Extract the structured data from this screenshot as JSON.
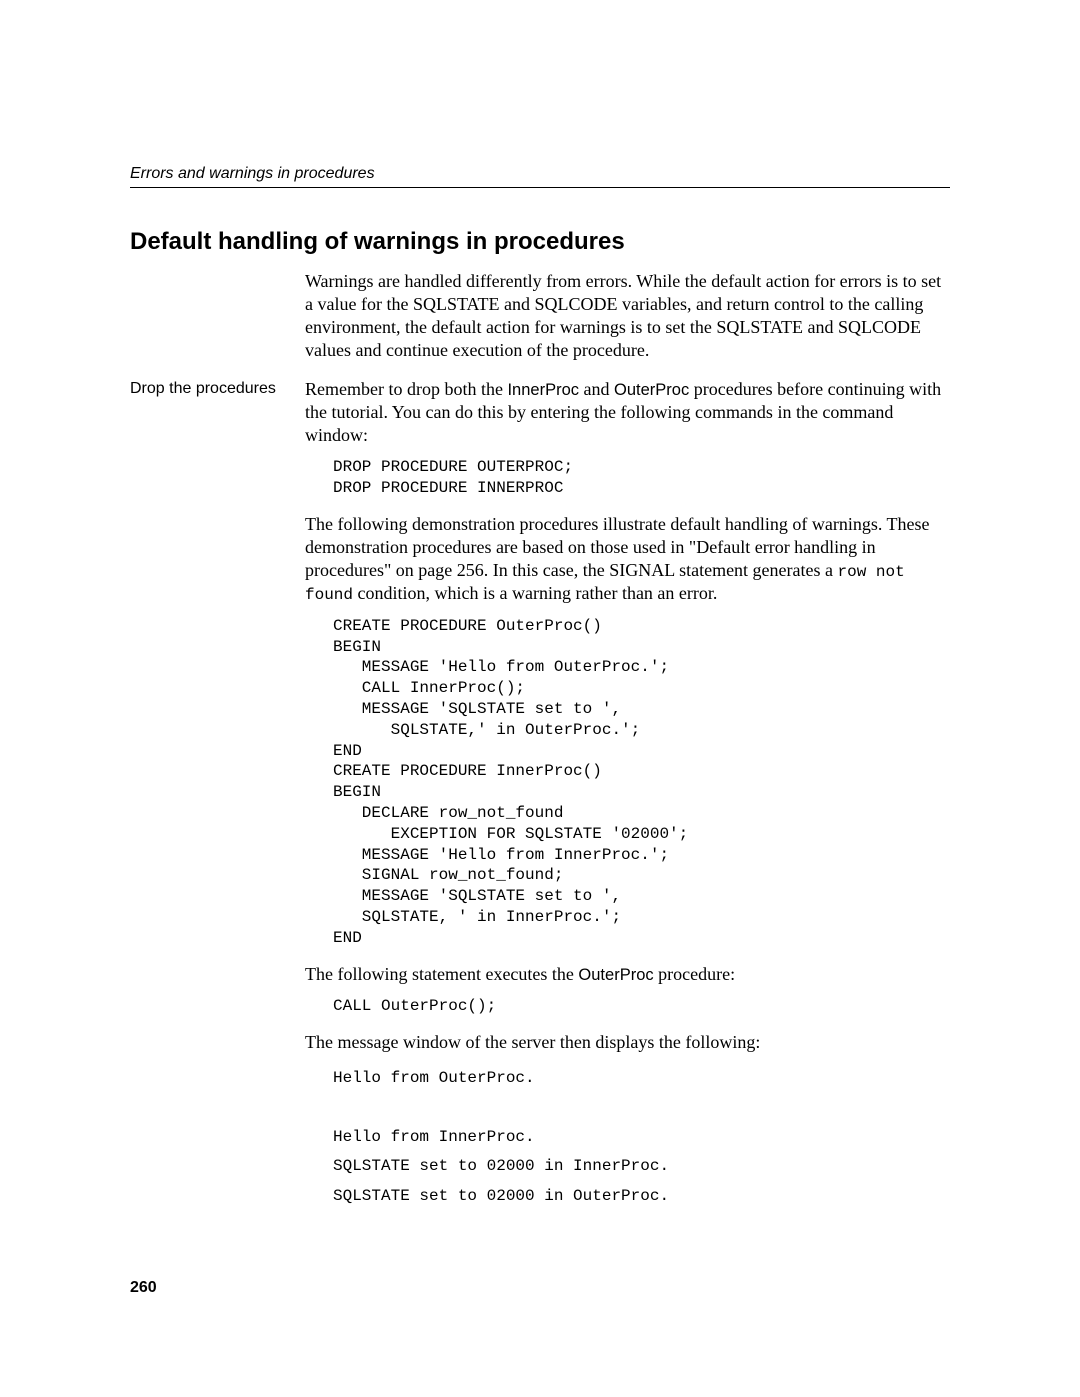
{
  "running_header": "Errors and warnings in procedures",
  "section_title": "Default handling of warnings in procedures",
  "intro_paragraph": "Warnings are handled differently from errors. While the default action for errors is to set a value for the SQLSTATE and SQLCODE variables, and return control to the calling environment, the default action for warnings is to set the SQLSTATE and SQLCODE values and continue execution of the procedure.",
  "sidehead_drop": "Drop the procedures",
  "drop_para_1": "Remember to drop both the ",
  "drop_inner": "InnerProc",
  "drop_and": " and ",
  "drop_outer": "OuterProc",
  "drop_para_2": " procedures before continuing with the tutorial. You can do this by entering the following commands in the command window:",
  "code_drop": "DROP PROCEDURE OUTERPROC;\nDROP PROCEDURE INNERPROC",
  "demo_para_1": "The following demonstration procedures illustrate default handling of warnings. These demonstration procedures are based on those used in \"Default error handling in procedures\" on page 256. In this case, the SIGNAL statement generates a ",
  "demo_mono": "row not found",
  "demo_para_2": " condition, which is a warning rather than an error.",
  "code_proc": "CREATE PROCEDURE OuterProc()\nBEGIN\n   MESSAGE 'Hello from OuterProc.';\n   CALL InnerProc();\n   MESSAGE 'SQLSTATE set to ',\n      SQLSTATE,' in OuterProc.';\nEND\nCREATE PROCEDURE InnerProc()\nBEGIN\n   DECLARE row_not_found\n      EXCEPTION FOR SQLSTATE '02000';\n   MESSAGE 'Hello from InnerProc.';\n   SIGNAL row_not_found;\n   MESSAGE 'SQLSTATE set to ',\n   SQLSTATE, ' in InnerProc.';\nEND",
  "exec_para_1": "The following statement executes the ",
  "exec_outer": "OuterProc",
  "exec_para_2": " procedure:",
  "code_call": "CALL OuterProc();",
  "msg_para": "The message window of the server then displays the following:",
  "output_text": "Hello from OuterProc.\n\nHello from InnerProc.\nSQLSTATE set to 02000 in InnerProc.\nSQLSTATE set to 02000 in OuterProc.",
  "page_number": "260"
}
